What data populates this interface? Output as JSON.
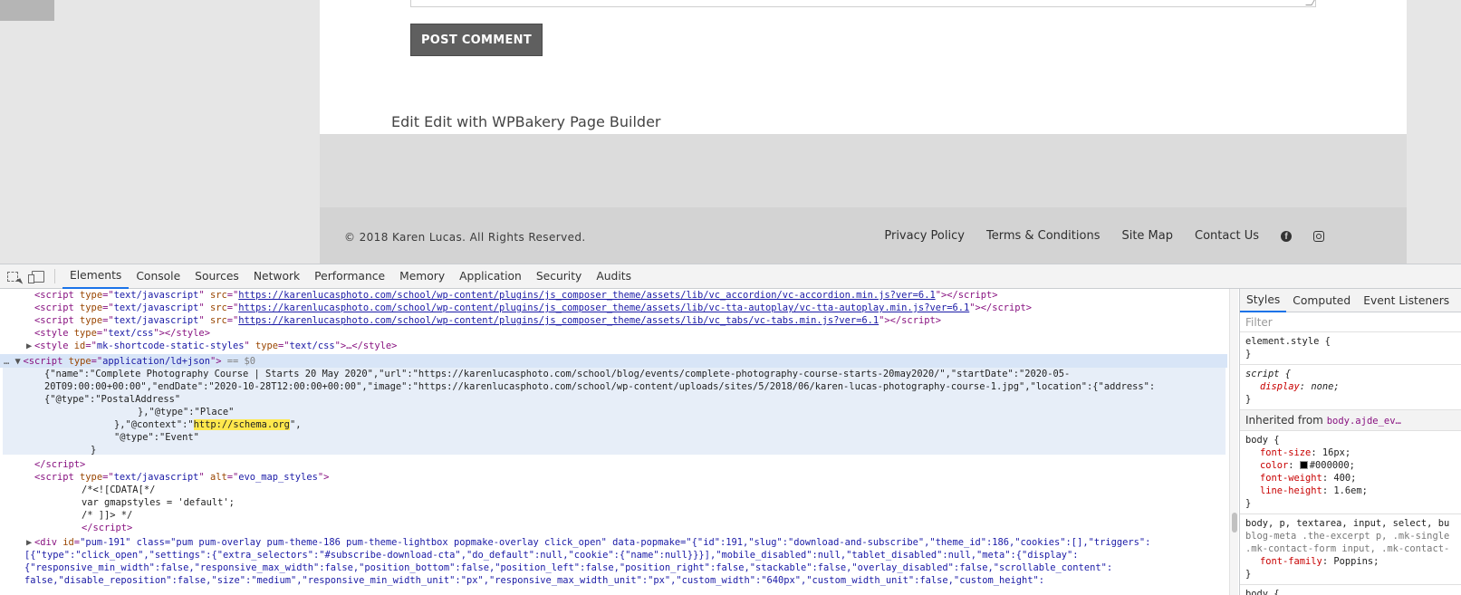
{
  "site": {
    "post_comment_label": "POST COMMENT",
    "edit_link": "Edit Edit with WPBakery Page Builder",
    "copyright": "© 2018 Karen Lucas. All Rights Reserved.",
    "footer_links": [
      "Privacy Policy",
      "Terms & Conditions",
      "Site Map",
      "Contact Us"
    ],
    "social_icons": [
      "facebook-icon",
      "instagram-icon"
    ]
  },
  "devtools": {
    "tabs": [
      "Elements",
      "Console",
      "Sources",
      "Network",
      "Performance",
      "Memory",
      "Application",
      "Security",
      "Audits"
    ],
    "active_tab": "Elements",
    "elements": {
      "script1_src": "https://karenlucasphoto.com/school/wp-content/plugins/js_composer_theme/assets/lib/vc_accordion/vc-accordion.min.js?ver=6.1",
      "script2_src": "https://karenlucasphoto.com/school/wp-content/plugins/js_composer_theme/assets/lib/vc-tta-autoplay/vc-tta-autoplay.min.js?ver=6.1",
      "script3_src": "https://karenlucasphoto.com/school/wp-content/plugins/js_composer_theme/assets/lib/vc_tabs/vc-tabs.min.js?ver=6.1",
      "text_javascript": "text/javascript",
      "text_css": "text/css",
      "style_id": "mk-shortcode-static-styles",
      "ldjson_type": "application/ld+json",
      "selected_marker": "== $0",
      "json_line1": "{\"name\":\"Complete Photography Course | Starts 20 May 2020\",\"url\":\"https://karenlucasphoto.com/school/blog/events/complete-photography-course-starts-20may2020/\",\"startDate\":\"2020-05-",
      "json_line2": "20T09:00:00+00:00\",\"endDate\":\"2020-10-28T12:00:00+00:00\",\"image\":\"https://karenlucasphoto.com/school/wp-content/uploads/sites/5/2018/06/karen-lucas-photography-course-1.jpg\",\"location\":{\"address\":",
      "json_line3": "{\"@type\":\"PostalAddress\"",
      "json_line4": "},\"@type\":\"Place\"",
      "json_line5a": "},\"@context\":\"",
      "json_context_url": "http://schema.org",
      "json_line5b": "\",",
      "json_line6": "\"@type\":\"Event\"",
      "json_line7": "}",
      "map_alt": "evo_map_styles",
      "cdata_open": "/*<![CDATA[*/",
      "gmapstyles": "var gmapstyles = 'default';",
      "cdata_close": "/* ]]> */",
      "pum_line1": "\"pum-191\" class=\"pum pum-overlay pum-theme-186 pum-theme-lightbox popmake-overlay click_open\" data-popmake=\"{\"id\":191,\"slug\":\"download-and-subscribe\",\"theme_id\":186,\"cookies\":[],\"triggers\":",
      "pum_line2": "[{\"type\":\"click_open\",\"settings\":{\"extra_selectors\":\"#subscribe-download-cta\",\"do_default\":null,\"cookie\":{\"name\":null}}}],\"mobile_disabled\":null,\"tablet_disabled\":null,\"meta\":{\"display\":",
      "pum_line3": "{\"responsive_min_width\":false,\"responsive_max_width\":false,\"position_bottom\":false,\"position_left\":false,\"position_right\":false,\"stackable\":false,\"overlay_disabled\":false,\"scrollable_content\":",
      "pum_line4": "false,\"disable_reposition\":false,\"size\":\"medium\",\"responsive_min_width_unit\":\"px\",\"responsive_max_width_unit\":\"px\",\"custom_width\":\"640px\",\"custom_width_unit\":false,\"custom_height\":"
    },
    "styles_pane": {
      "tabs": [
        "Styles",
        "Computed",
        "Event Listeners"
      ],
      "filter_placeholder": "Filter",
      "element_style": "element.style {",
      "script_selector": "script {",
      "display_prop": "display",
      "display_val": "none;",
      "inherited_label": "Inherited from",
      "inherited_from": "body.ajde_ev…",
      "body_selector": "body {",
      "font_size_prop": "font-size",
      "font_size_val": "16px;",
      "color_prop": "color",
      "color_val": "#000000;",
      "font_weight_prop": "font-weight",
      "font_weight_val": "400;",
      "line_height_prop": "line-height",
      "line_height_val": "1.6em;",
      "multi_selector_1": "body, p, textarea, input, select, bu",
      "multi_selector_2": "blog-meta .the-excerpt p, .mk-single",
      "multi_selector_3": ".mk-contact-form input, .mk-contact-",
      "font_family_prop": "font-family",
      "font_family_val": "Poppins;",
      "body_selector_2": "body {",
      "close_brace": "}"
    }
  }
}
